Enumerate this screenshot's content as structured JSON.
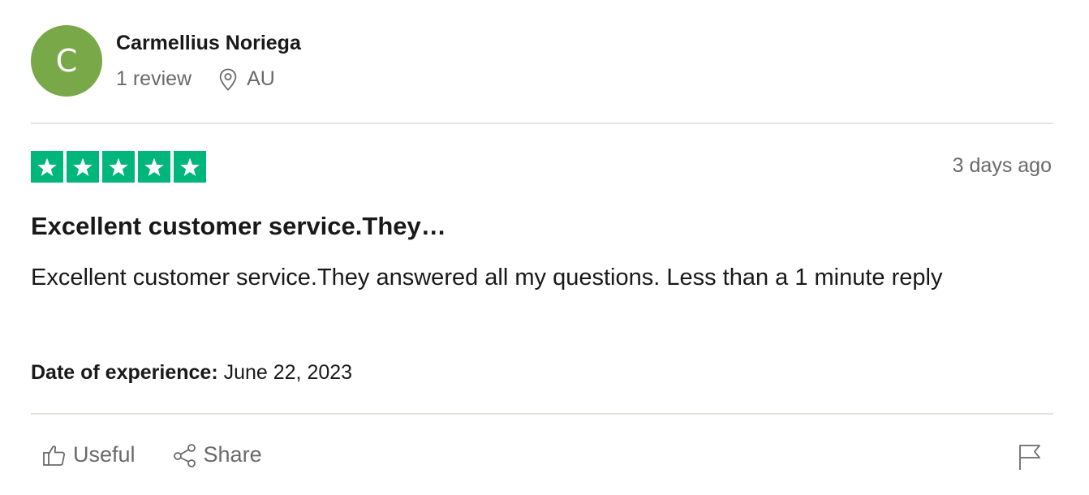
{
  "consumer": {
    "initial": "C",
    "name": "Carmellius Noriega",
    "review_count": "1 review",
    "country": "AU",
    "avatar_color": "#79a848"
  },
  "review": {
    "rating": 5,
    "rating_max": 5,
    "star_color": "#00b67a",
    "posted": "3 days ago",
    "title": "Excellent customer service.They…",
    "body": "Excellent customer service.They answered all my questions. Less than a 1 minute reply",
    "experience_label": "Date of experience:",
    "experience_date": "June 22, 2023"
  },
  "actions": {
    "useful_label": "Useful",
    "share_label": "Share",
    "useful_icon": "thumbs-up-icon",
    "share_icon": "share-icon",
    "report_icon": "flag-icon"
  }
}
